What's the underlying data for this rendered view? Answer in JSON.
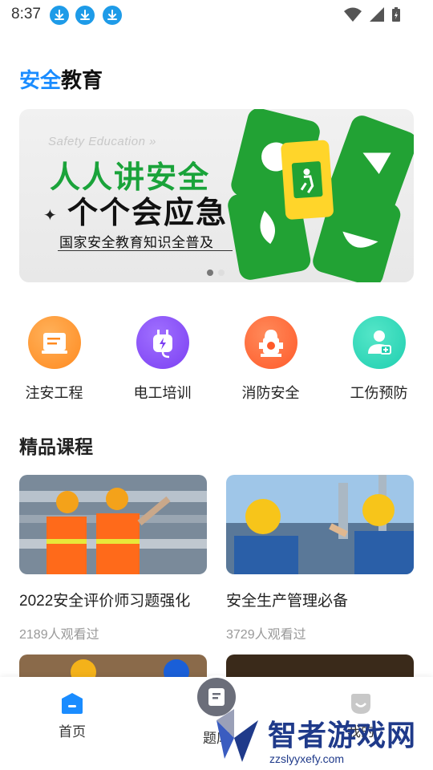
{
  "status_bar": {
    "time": "8:37",
    "notifications": [
      "download-icon",
      "download-icon",
      "download-icon"
    ],
    "right_icons": [
      "wifi-icon",
      "signal-icon",
      "battery-icon"
    ]
  },
  "brand": {
    "accent": "安全",
    "rest": "教育"
  },
  "banner": {
    "subtitle": "Safety Education",
    "line1": "人人讲安全",
    "line2": "个个会应急",
    "line3": "国家安全教育知识全普及",
    "page_count": 2,
    "active_page": 1
  },
  "categories": [
    {
      "label": "注安工程",
      "icon": "document-icon",
      "color": "#ff8a1f"
    },
    {
      "label": "电工培训",
      "icon": "plug-icon",
      "color": "#7b3ff2"
    },
    {
      "label": "消防安全",
      "icon": "fire-hydrant-icon",
      "color": "#ff5a2a"
    },
    {
      "label": "工伤预防",
      "icon": "injured-person-icon",
      "color": "#1fcfb0"
    }
  ],
  "section": {
    "title": "精品课程"
  },
  "courses": [
    {
      "title": "2022安全评价师习题强化",
      "views": "2189人观看过"
    },
    {
      "title": "安全生产管理必备",
      "views": "3729人观看过"
    }
  ],
  "bottom_nav": [
    {
      "label": "首页",
      "icon": "home-icon",
      "active": true
    },
    {
      "label": "题库",
      "icon": "question-bank-icon",
      "active": false
    },
    {
      "label": "我的",
      "icon": "profile-icon",
      "active": false
    }
  ],
  "watermark": {
    "text": "智者游戏网",
    "sub": "zzslyyxefy.com"
  },
  "colors": {
    "accent": "#1a8cff",
    "green": "#1aa33a"
  }
}
